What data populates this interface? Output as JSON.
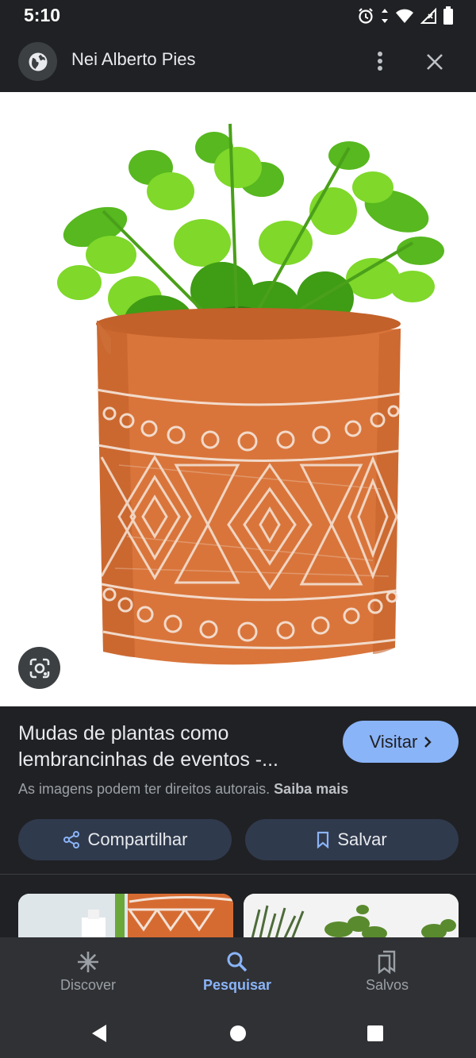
{
  "status_bar": {
    "time": "5:10",
    "icons": [
      "alarm-icon",
      "data-arrows-icon",
      "wifi-icon",
      "signal-icon",
      "battery-icon"
    ]
  },
  "app_bar": {
    "site_name": "Nei Alberto Pies",
    "site_icon": "globe-icon",
    "more_icon": "more-vert-icon",
    "close_icon": "close-icon"
  },
  "image": {
    "lens_icon": "lens-icon"
  },
  "result": {
    "title": "Mudas de plantas como lembrancinhas de eventos -...",
    "visit_label": "Visitar",
    "copyright_text": "As imagens podem ter direitos autorais.",
    "learn_more_label": "Saiba mais",
    "share_label": "Compartilhar",
    "save_label": "Salvar"
  },
  "bottom_nav": {
    "items": [
      {
        "label": "Discover",
        "icon": "asterisk-icon",
        "active": false
      },
      {
        "label": "Pesquisar",
        "icon": "search-icon",
        "active": true
      },
      {
        "label": "Salvos",
        "icon": "bookmarks-icon",
        "active": false
      }
    ]
  },
  "system_nav": {
    "back_icon": "back-triangle-icon",
    "home_icon": "home-circle-icon",
    "recents_icon": "recents-square-icon"
  },
  "colors": {
    "background": "#202124",
    "accent": "#8ab4f8",
    "button_bg": "#303a4d",
    "nav_bg": "#303134",
    "pot": "#d9753b"
  }
}
